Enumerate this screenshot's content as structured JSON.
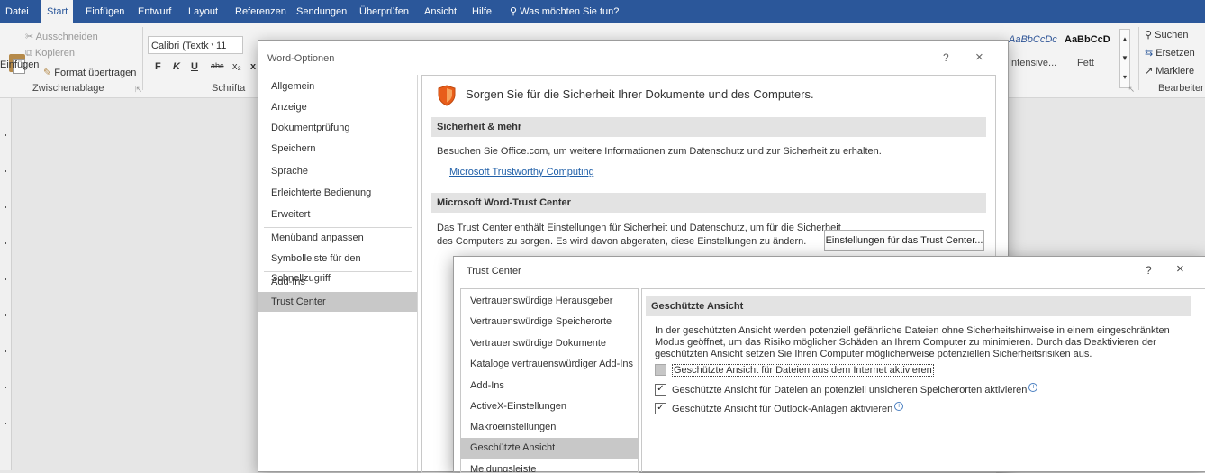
{
  "ribbon": {
    "tabs": [
      "Datei",
      "Start",
      "Einfügen",
      "Entwurf",
      "Layout",
      "Referenzen",
      "Sendungen",
      "Überprüfen",
      "Ansicht",
      "Hilfe"
    ],
    "tell_me": "Was möchten Sie tun?",
    "clipboard": {
      "paste": "Einfügen",
      "cut": "Ausschneiden",
      "copy": "Kopieren",
      "format_painter": "Format übertragen",
      "group_label": "Zwischenablage"
    },
    "font": {
      "name": "Calibri (Textk",
      "size": "11",
      "group_label": "Schrifta",
      "buttons": [
        "F",
        "K",
        "U",
        "abc",
        "x₂",
        "x"
      ]
    },
    "styles": {
      "style1_preview": "AaBbCcDc",
      "style1_name": "Intensive...",
      "style2_preview": "AaBbCcD",
      "style2_name": "Fett"
    },
    "editing": {
      "search": "Suchen",
      "replace": "Ersetzen",
      "select": "Markiere",
      "group_label": "Bearbeiter"
    }
  },
  "word_options": {
    "title": "Word-Optionen",
    "help": "?",
    "close": "×",
    "nav": [
      "Allgemein",
      "Anzeige",
      "Dokumentprüfung",
      "Speichern",
      "Sprache",
      "Erleichterte Bedienung",
      "Erweitert",
      "Menüband anpassen",
      "Symbolleiste für den Schnellzugriff",
      "Add-Ins",
      "Trust Center"
    ],
    "selected_nav": "Trust Center",
    "heading": "Sorgen Sie für die Sicherheit Ihrer Dokumente und des Computers.",
    "section1_title": "Sicherheit & mehr",
    "section1_text": "Besuchen Sie Office.com, um weitere Informationen zum Datenschutz und zur Sicherheit zu erhalten.",
    "section1_link": "Microsoft Trustworthy Computing",
    "section2_title": "Microsoft Word-Trust Center",
    "section2_text_line1": "Das Trust Center enthält Einstellungen für Sicherheit und Datenschutz, um für die Sicherheit",
    "section2_text_line2": "des Computers zu sorgen. Es wird davon abgeraten, diese Einstellungen zu ändern.",
    "trust_center_button": "Einstellungen für das Trust Center..."
  },
  "trust_center": {
    "title": "Trust Center",
    "help": "?",
    "close": "×",
    "nav": [
      "Vertrauenswürdige Herausgeber",
      "Vertrauenswürdige Speicherorte",
      "Vertrauenswürdige Dokumente",
      "Kataloge vertrauenswürdiger Add-Ins",
      "Add-Ins",
      "ActiveX-Einstellungen",
      "Makroeinstellungen",
      "Geschützte Ansicht",
      "Meldungsleiste"
    ],
    "selected_nav": "Geschützte Ansicht",
    "section_title": "Geschützte Ansicht",
    "description": "In der geschützten Ansicht werden potenziell gefährliche Dateien ohne Sicherheitshinweise in einem eingeschränkten Modus geöffnet, um das Risiko möglicher Schäden an Ihrem Computer zu minimieren. Durch das Deaktivieren der geschützten Ansicht setzen Sie Ihren Computer möglicherweise potenziellen Sicherheitsrisiken aus.",
    "options": [
      {
        "label": "Geschützte Ansicht für Dateien aus dem Internet aktivieren",
        "checked": false
      },
      {
        "label": "Geschützte Ansicht für Dateien an potenziell unsicheren Speicherorten aktivieren",
        "checked": true
      },
      {
        "label": "Geschützte Ansicht für Outlook-Anlagen aktivieren",
        "checked": true
      }
    ]
  }
}
